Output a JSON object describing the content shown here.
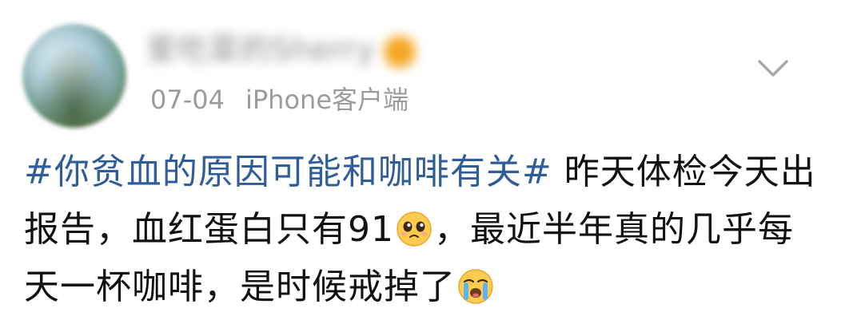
{
  "post": {
    "username": "爱吃菜的Sherry",
    "date": "07-04",
    "source": "iPhone客户端",
    "topic": "#你贫血的原因可能和咖啡有关#",
    "text_part1": "昨天体检今天出报告，血红蛋白只有91",
    "text_part2": "，最近半年真的几乎每天一杯咖啡，是时候戒掉了",
    "emoji1": "pleading-face-emoji",
    "emoji2": "loudly-crying-face-emoji"
  },
  "icons": {
    "chevron": "chevron-down-icon"
  },
  "colors": {
    "topic": "#2f5d99",
    "text": "#111111",
    "meta": "#9b9b9b",
    "badge": "#f5a623"
  }
}
